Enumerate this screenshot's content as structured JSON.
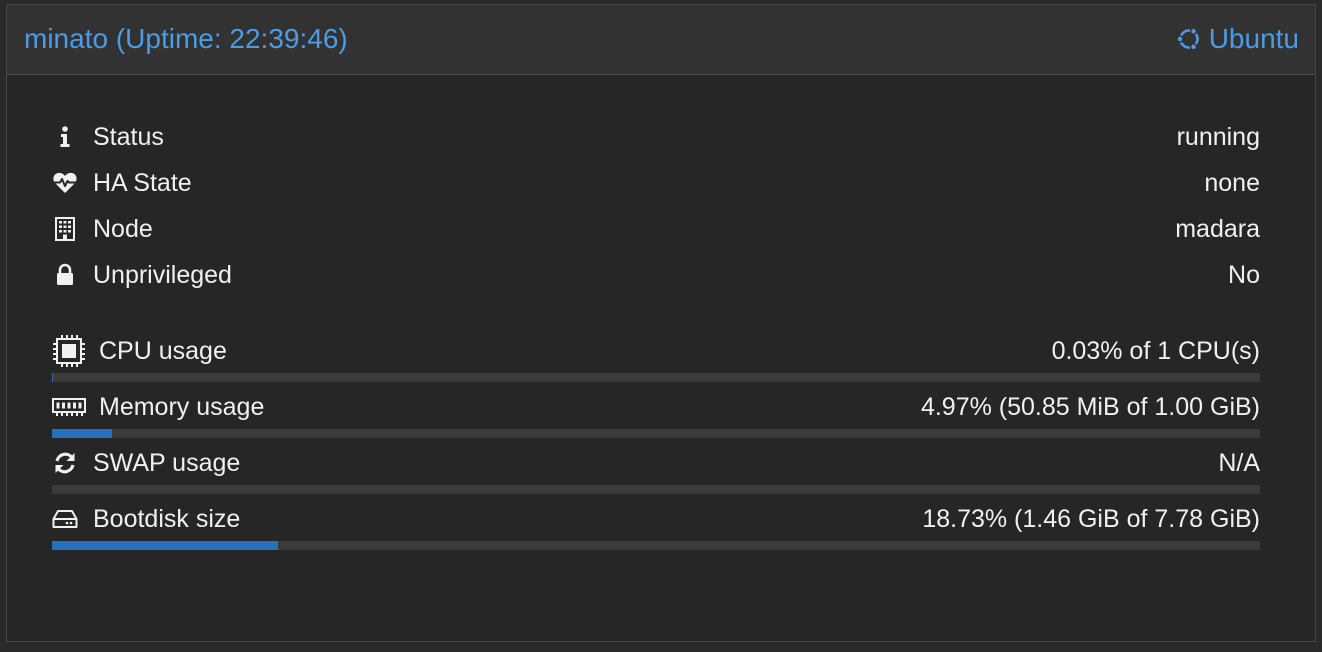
{
  "header": {
    "title": "minato (Uptime: 22:39:46)",
    "os_label": "Ubuntu",
    "os_icon": "ubuntu-icon",
    "accent_color": "#4b9ce6"
  },
  "info": {
    "status": {
      "icon": "info-icon",
      "label": "Status",
      "value": "running"
    },
    "ha_state": {
      "icon": "heartbeat-icon",
      "label": "HA State",
      "value": "none"
    },
    "node": {
      "icon": "building-icon",
      "label": "Node",
      "value": "madara"
    },
    "unprivileged": {
      "icon": "lock-icon",
      "label": "Unprivileged",
      "value": "No"
    }
  },
  "usage": {
    "cpu": {
      "icon": "cpu-chip-icon",
      "label": "CPU usage",
      "value": "0.03% of 1 CPU(s)",
      "fraction": 0.0003
    },
    "memory": {
      "icon": "memory-icon",
      "label": "Memory usage",
      "value": "4.97% (50.85 MiB of 1.00 GiB)",
      "fraction": 0.0497
    },
    "swap": {
      "icon": "refresh-icon",
      "label": "SWAP usage",
      "value": "N/A",
      "fraction": 0
    },
    "bootdisk": {
      "icon": "hdd-icon",
      "label": "Bootdisk size",
      "value": "18.73% (1.46 GiB of 7.78 GiB)",
      "fraction": 0.1873
    }
  },
  "bar_color": "#2670bc"
}
